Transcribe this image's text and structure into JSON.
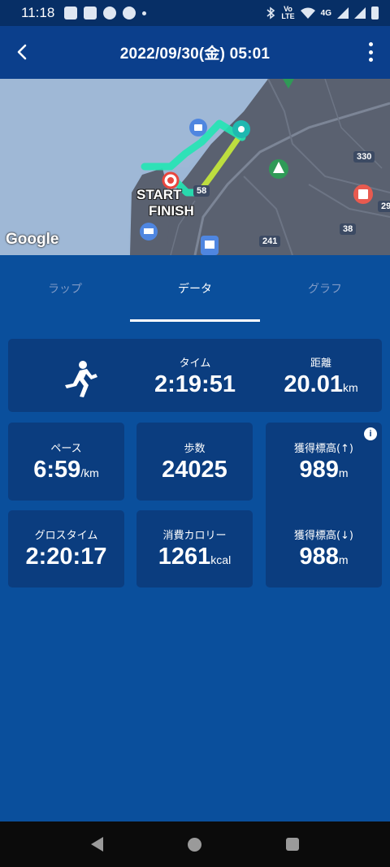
{
  "status_bar": {
    "time": "11:18",
    "icons_left": [
      "line-icon",
      "facebook-icon",
      "chrome-icon",
      "chrome-icon",
      "dot-icon"
    ],
    "icons_right": [
      "bluetooth-icon",
      "volte-icon",
      "wifi-icon",
      "signal-icon",
      "battery-icon"
    ],
    "volte_top": "Vo",
    "volte_bottom": "LTE",
    "network": "4G"
  },
  "app_bar": {
    "title": "2022/09/30(金) 05:01",
    "back_icon": "chevron-left-icon",
    "menu_icon": "more-vert-icon"
  },
  "map": {
    "google_label": "Google",
    "start_label": "START",
    "finish_label": "FINISH",
    "road_labels": [
      "58",
      "330",
      "241",
      "38",
      "29"
    ]
  },
  "tabs": [
    {
      "label": "ラップ",
      "active": false
    },
    {
      "label": "データ",
      "active": true
    },
    {
      "label": "グラフ",
      "active": false
    }
  ],
  "stats": {
    "time": {
      "label": "タイム",
      "value": "2:19:51"
    },
    "distance": {
      "label": "距離",
      "value": "20.01",
      "unit": "km"
    },
    "pace": {
      "label": "ペース",
      "value": "6:59",
      "unit": "/km"
    },
    "steps": {
      "label": "歩数",
      "value": "24025"
    },
    "elevation_up": {
      "label": "獲得標高(↑)",
      "value": "989",
      "unit": "m"
    },
    "gross_time": {
      "label": "グロスタイム",
      "value": "2:20:17"
    },
    "calories": {
      "label": "消費カロリー",
      "value": "1261",
      "unit": "kcal"
    },
    "elevation_down": {
      "label": "獲得標高(↓)",
      "value": "988",
      "unit": "m"
    }
  },
  "colors": {
    "background": "#0a4f9c",
    "app_bar": "#0b3f8c",
    "card": "#0b3d7f",
    "route": "#22e6b4",
    "start_marker": "#e8463e"
  }
}
